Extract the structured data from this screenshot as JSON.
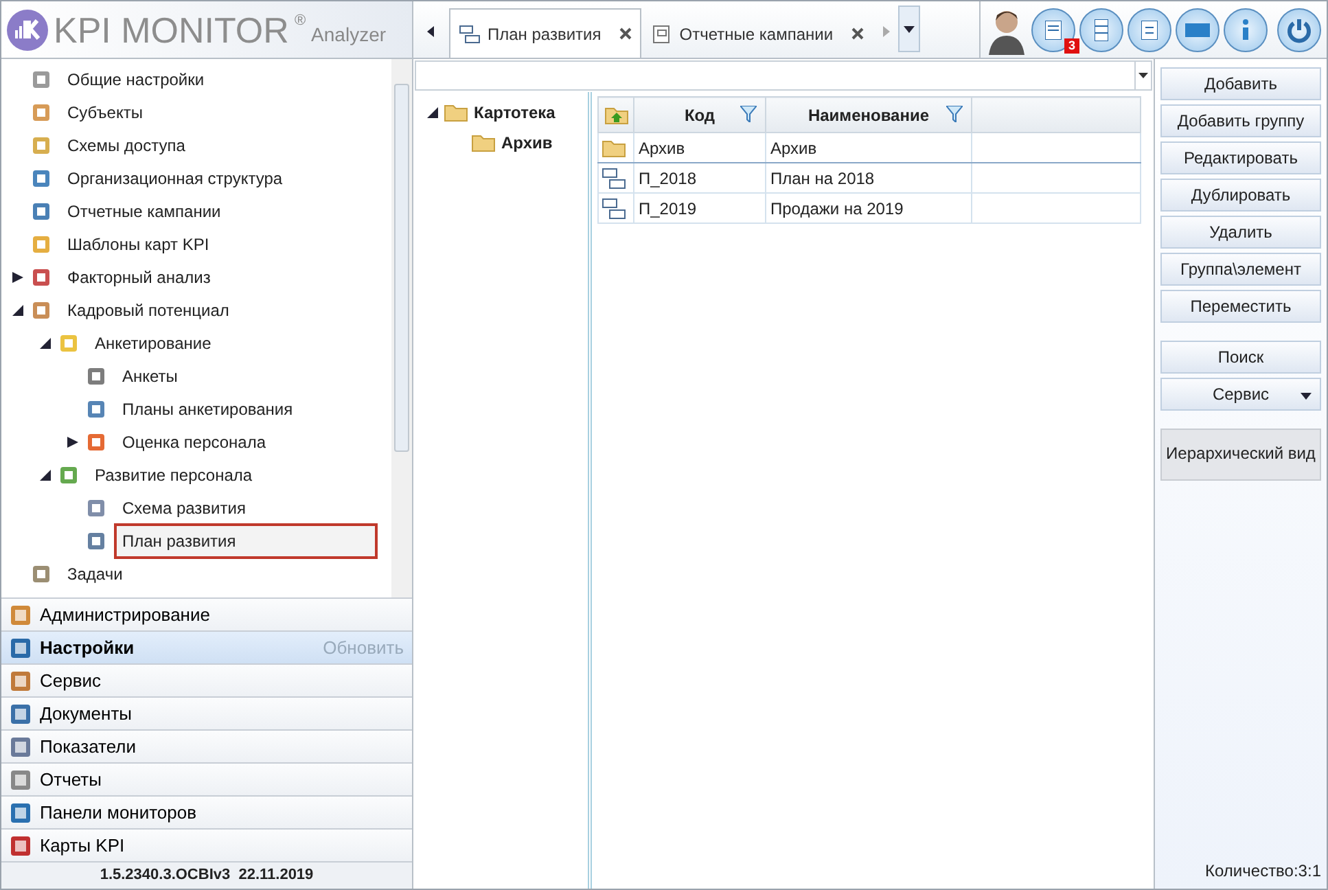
{
  "header": {
    "logo_text": "KPI MONITOR",
    "logo_mark": "®",
    "logo_subtitle": "Analyzer",
    "tabs": [
      {
        "label": "План развития",
        "selected": true
      },
      {
        "label": "Отчетные кампании",
        "selected": false
      }
    ],
    "notification_count": "3"
  },
  "nav_tree": [
    {
      "label": "Общие настройки",
      "selected": false
    },
    {
      "label": "Субъекты",
      "selected": false
    },
    {
      "label": "Схемы доступа",
      "selected": false
    },
    {
      "label": "Организационная структура",
      "selected": false
    },
    {
      "label": "Отчетные кампании",
      "selected": false
    },
    {
      "label": "Шаблоны карт KPI",
      "selected": false
    },
    {
      "label": "Факторный анализ",
      "selected": false,
      "expanded": false
    },
    {
      "label": "Кадровый потенциал",
      "selected": false,
      "expanded": true,
      "children": [
        {
          "label": "Анкетирование",
          "selected": false,
          "expanded": true,
          "children": [
            {
              "label": "Анкеты",
              "selected": false
            },
            {
              "label": "Планы анкетирования",
              "selected": false
            },
            {
              "label": "Оценка персонала",
              "selected": false,
              "expanded": false
            }
          ]
        },
        {
          "label": "Развитие персонала",
          "selected": false,
          "expanded": true,
          "children": [
            {
              "label": "Схема развития",
              "selected": false
            },
            {
              "label": "План развития",
              "selected": true
            }
          ]
        }
      ]
    },
    {
      "label": "Задачи",
      "selected": false
    }
  ],
  "sections": [
    {
      "label": "Администрирование",
      "selected": false
    },
    {
      "label": "Настройки",
      "selected": true,
      "action": "Обновить"
    },
    {
      "label": "Сервис",
      "selected": false
    },
    {
      "label": "Документы",
      "selected": false
    },
    {
      "label": "Показатели",
      "selected": false
    },
    {
      "label": "Отчеты",
      "selected": false
    },
    {
      "label": "Панели мониторов",
      "selected": false
    },
    {
      "label": "Карты KPI",
      "selected": false
    }
  ],
  "version": "1.5.2340.3.OCBIv3  22.11.2019",
  "folder_tree": [
    {
      "label": "Картотека",
      "expanded": true,
      "children": [
        {
          "label": "Архив"
        }
      ]
    }
  ],
  "table": {
    "columns": [
      "Код",
      "Наименование"
    ],
    "rows": [
      {
        "kind": "folder",
        "code": "Архив",
        "name": "Архив",
        "selected": true
      },
      {
        "kind": "plan",
        "code": "П_2018",
        "name": "План на 2018",
        "selected": false
      },
      {
        "kind": "plan",
        "code": "П_2019",
        "name": "Продажи на 2019",
        "selected": false
      }
    ]
  },
  "button_groups": [
    [
      {
        "label": "Добавить"
      },
      {
        "label": "Добавить группу"
      },
      {
        "label": "Редактировать"
      },
      {
        "label": "Дублировать"
      },
      {
        "label": "Удалить"
      },
      {
        "label": "Группа\\элемент"
      },
      {
        "label": "Переместить"
      }
    ],
    [
      {
        "label": "Поиск"
      },
      {
        "label": "Сервис",
        "kind": "dropdown"
      }
    ],
    [
      {
        "label": "Иерархический вид",
        "kind": "toggle",
        "pressed": true
      }
    ]
  ],
  "count": "Количество:3:1"
}
